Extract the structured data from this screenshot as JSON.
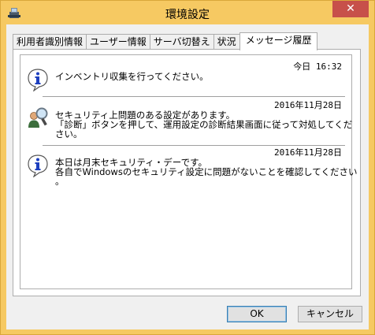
{
  "window": {
    "title": "環境設定",
    "close_label": "✕"
  },
  "tabs": [
    {
      "label": "利用者識別情報"
    },
    {
      "label": "ユーザー情報"
    },
    {
      "label": "サーバ切替え"
    },
    {
      "label": "状況"
    },
    {
      "label": "メッセージ履歴",
      "active": true
    }
  ],
  "messages": [
    {
      "icon": "info-icon",
      "date": "今日 16:32",
      "lines": [
        "インベントリ収集を行ってください。"
      ]
    },
    {
      "icon": "user-search-icon",
      "date": "2016年11月28日",
      "lines": [
        "セキュリティ上問題のある設定があります。",
        "「診断」ボタンを押して、運用設定の診断結果画面に従って対処してくだ",
        "さい。"
      ]
    },
    {
      "icon": "info-icon",
      "date": "2016年11月28日",
      "lines": [
        "本日は月末セキュリティ・デーです。",
        "各自でWindowsのセキュリティ設定に問題がないことを確認してください",
        "。"
      ]
    }
  ],
  "buttons": {
    "ok": "OK",
    "cancel": "キャンセル"
  }
}
